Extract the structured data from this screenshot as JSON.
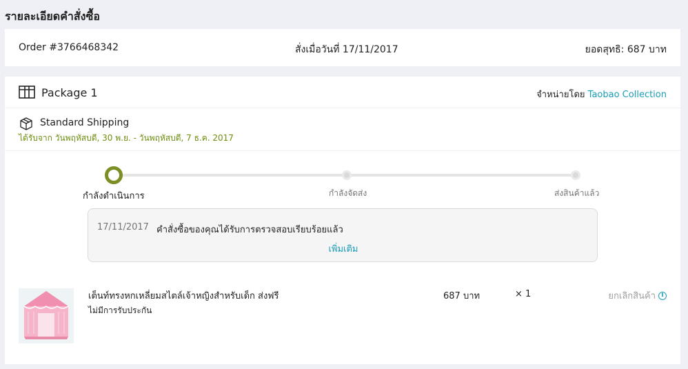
{
  "page": {
    "title": "รายละเอียดคำสั่งซื้อ"
  },
  "order": {
    "number": "Order #3766468342",
    "placed_on": "สั่งเมื่อวันที่ 17/11/2017",
    "total": "ยอดสุทธิ: 687 บาท"
  },
  "package": {
    "label": "Package 1",
    "seller_prefix": "จำหน่ายโดย",
    "seller_name": "Taobao Collection",
    "shipping_method": "Standard Shipping",
    "eta": "ได้รับจาก วันพฤหัสบดี, 30 พ.ย. - วันพฤหัสบดี, 7 ธ.ค. 2017",
    "steps": [
      {
        "label": "กำลังดำเนินการ",
        "active": true
      },
      {
        "label": "กำลังจัดส่ง",
        "active": false
      },
      {
        "label": "ส่งสินค้าแล้ว",
        "active": false
      }
    ],
    "status": {
      "date": "17/11/2017",
      "message": "คำสั่งซื้อของคุณได้รับการตรวจสอบเรียบร้อยแล้ว",
      "more": "เพิ่มเติม"
    },
    "item": {
      "name": "เต็นท์ทรงหกเหลี่ยมสไตล์เจ้าหญิงสำหรับเด็ก ส่งฟรี",
      "warranty": "ไม่มีการรับประกัน",
      "price": "687 บาท",
      "qty": "× 1",
      "cancel": "ยกเลิกสินค้า",
      "info_icon": "i"
    }
  },
  "colors": {
    "accent": "#1a9cb7",
    "progress": "#7b8f24",
    "eta": "#6d8d0d",
    "background": "#eff0f5"
  }
}
